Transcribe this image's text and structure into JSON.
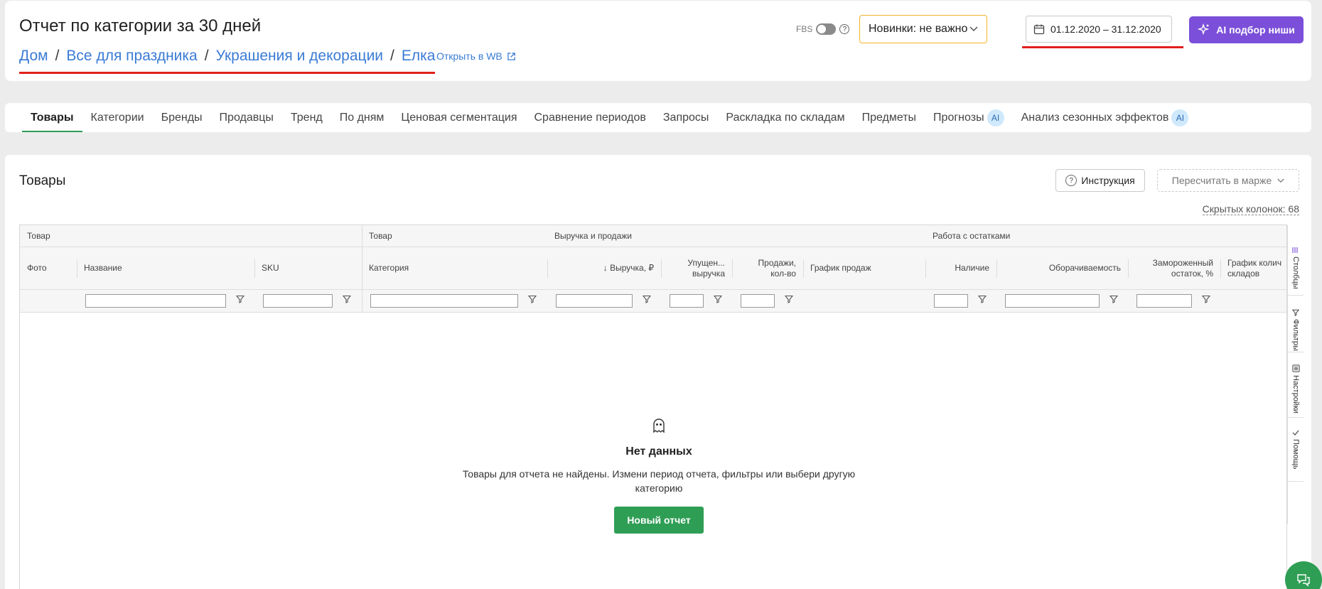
{
  "header": {
    "title": "Отчет по категории за 30 дней",
    "breadcrumb": [
      "Дом",
      "Все для праздника",
      "Украшения и декорации",
      "Елка"
    ],
    "open_wb": "Открыть в WB",
    "fbs_label": "FBS",
    "novinki": "Новинки: не важно",
    "date_range": "01.12.2020 – 31.12.2020",
    "ai_button": "AI подбор ниши"
  },
  "tabs": [
    {
      "label": "Товары",
      "active": true
    },
    {
      "label": "Категории"
    },
    {
      "label": "Бренды"
    },
    {
      "label": "Продавцы"
    },
    {
      "label": "Тренд"
    },
    {
      "label": "По дням"
    },
    {
      "label": "Ценовая сегментация"
    },
    {
      "label": "Сравнение периодов"
    },
    {
      "label": "Запросы"
    },
    {
      "label": "Раскладка по складам"
    },
    {
      "label": "Предметы"
    },
    {
      "label": "Прогнозы",
      "badge": "AI"
    },
    {
      "label": "Анализ сезонных эффектов",
      "badge": "AI"
    }
  ],
  "section": {
    "title": "Товары",
    "instruction": "Инструкция",
    "recalc": "Пересчитать в марже",
    "hidden_columns": "Скрытых колонок: 68"
  },
  "grid": {
    "groups": [
      "Товар",
      "Товар",
      "Выручка и продажи",
      "Работа с остатками"
    ],
    "columns": {
      "photo": "Фото",
      "name": "Название",
      "sku": "SKU",
      "category": "Категория",
      "revenue": "↓ Выручка, ₽",
      "lost_revenue_1": "Упущен...",
      "lost_revenue_2": "выручка",
      "sales_1": "Продажи,",
      "sales_2": "кол-во",
      "sales_chart": "График продаж",
      "stock": "Наличие",
      "turnover": "Оборачиваемость",
      "frozen_1": "Замороженный",
      "frozen_2": "остаток, %",
      "chart_qty_1": "График колич",
      "chart_qty_2": "складов"
    },
    "rail": [
      "Столбцы",
      "Фильтры",
      "Настройки",
      "Помощь"
    ]
  },
  "empty": {
    "title": "Нет данных",
    "desc_line1": "Товары для отчета не найдены. Измени период отчета, фильтры или выбери другую",
    "desc_line2": "категорию",
    "button": "Новый отчет"
  },
  "colors": {
    "accent_purple": "#7b4fd9",
    "accent_green": "#2f9e55",
    "link_blue": "#3a7bd5",
    "underline_red": "#e0201c",
    "border_orange": "#f0b429"
  }
}
